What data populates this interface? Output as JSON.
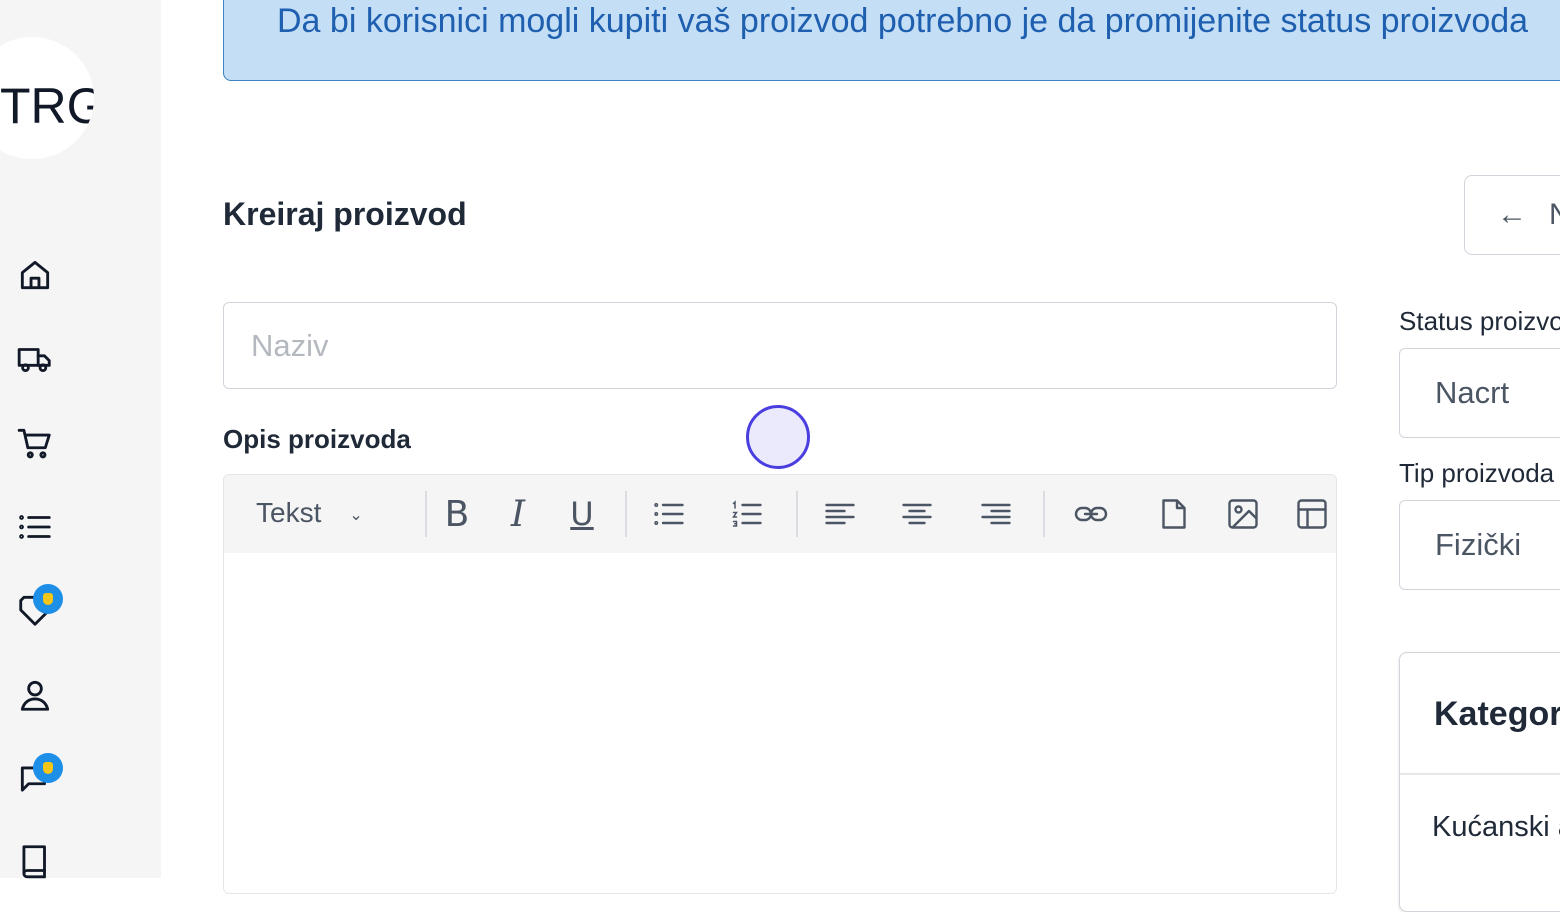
{
  "sidebar": {
    "logo_text": "TRG",
    "items": [
      {
        "icon": "home-icon"
      },
      {
        "icon": "truck-icon"
      },
      {
        "icon": "cart-icon"
      },
      {
        "icon": "list-icon"
      },
      {
        "icon": "tag-icon",
        "badge": true
      },
      {
        "icon": "user-icon"
      },
      {
        "icon": "message-icon",
        "badge": true
      },
      {
        "icon": "book-icon"
      }
    ]
  },
  "banner": {
    "text": "Da bi korisnici mogli kupiti vaš proizvod potrebno je da promijenite status proizvoda"
  },
  "header": {
    "title": "Kreiraj proizvod",
    "back_button": {
      "arrow": "←",
      "label": "Nazad"
    }
  },
  "form": {
    "name_placeholder": "Naziv",
    "name_value": "",
    "description_label": "Opis proizvoda",
    "editor": {
      "format_select": "Tekst",
      "format_chevron": "⌄",
      "bold": "B",
      "italic": "I",
      "underline": "U"
    }
  },
  "side": {
    "status_label": "Status proizvoda",
    "status_value": "Nacrt",
    "type_label": "Tip proizvoda",
    "type_value": "Fizički",
    "categories_title": "Kategorije",
    "categories": [
      "Kućanski aparati"
    ]
  }
}
